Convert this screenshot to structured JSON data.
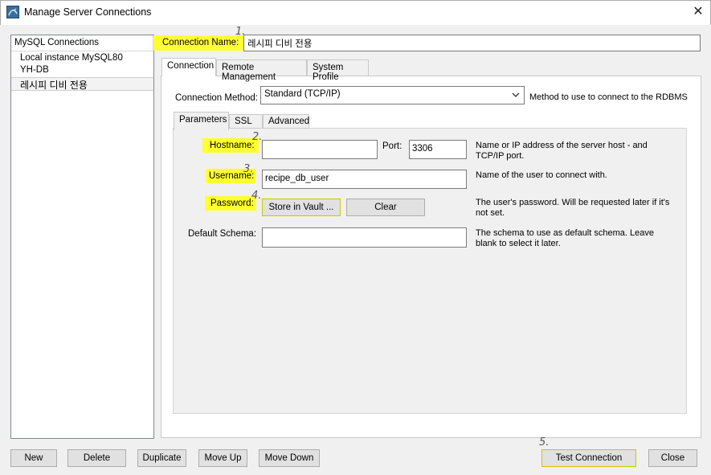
{
  "window": {
    "title": "Manage Server Connections",
    "close_glyph": "✕",
    "icon": "mysql-workbench-icon"
  },
  "sidebar": {
    "header": "MySQL Connections",
    "items": [
      {
        "label": "Local instance MySQL80"
      },
      {
        "label": "YH-DB"
      },
      {
        "label": "레시피 디비 전용",
        "selected": true
      }
    ]
  },
  "connection_name": {
    "label": "Connection Name:",
    "value": "레시피 디비 전용"
  },
  "tabs": [
    "Connection",
    "Remote Management",
    "System Profile"
  ],
  "connection_method": {
    "label": "Connection Method:",
    "value": "Standard (TCP/IP)",
    "description": "Method to use to connect to the RDBMS"
  },
  "subtabs": [
    "Parameters",
    "SSL",
    "Advanced"
  ],
  "params": {
    "hostname_label": "Hostname:",
    "hostname_value": "",
    "port_label": "Port:",
    "port_value": "3306",
    "hostname_desc": "Name or IP address of the server host - and TCP/IP port.",
    "username_label": "Username:",
    "username_value": "recipe_db_user",
    "username_desc": "Name of the user to connect with.",
    "password_label": "Password:",
    "store_vault_label": "Store in Vault ...",
    "clear_label": "Clear",
    "password_desc": "The user's password. Will be requested later if it's not set.",
    "schema_label": "Default Schema:",
    "schema_value": "",
    "schema_desc": "The schema to use as default schema. Leave blank to select it later."
  },
  "buttons": {
    "new": "New",
    "delete": "Delete",
    "duplicate": "Duplicate",
    "move_up": "Move Up",
    "move_down": "Move Down",
    "test_connection": "Test Connection",
    "close": "Close"
  },
  "annotations": [
    "1.",
    "2.",
    "3.",
    "4.",
    "5."
  ],
  "colors": {
    "highlight": "#ffff33",
    "accent": "#3b6e9a"
  }
}
